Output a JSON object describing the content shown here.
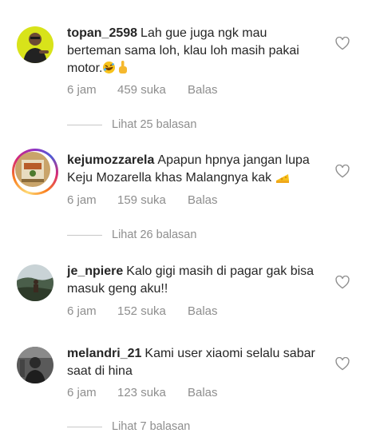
{
  "comments": [
    {
      "username": "topan_2598",
      "text": "Lah gue juga ngk mau berteman sama loh, klau loh masih pakai motor.",
      "emoji": [
        "rolling-laughing-emoji",
        "pointing-up-emoji"
      ],
      "time": "6 jam",
      "likes": "459 suka",
      "reply_label": "Balas",
      "view_replies": "Lihat 25 balasan"
    },
    {
      "username": "kejumozzarela",
      "text": "Apapun hpnya jangan lupa Keju Mozarella khas Malangnya kak",
      "emoji": [
        "cheese-emoji"
      ],
      "time": "6 jam",
      "likes": "159 suka",
      "reply_label": "Balas",
      "view_replies": "Lihat 26 balasan"
    },
    {
      "username": "je_npiere",
      "text": "Kalo gigi masih di pagar gak bisa masuk geng aku!!",
      "time": "6 jam",
      "likes": "152 suka",
      "reply_label": "Balas"
    },
    {
      "username": "melandri_21",
      "text": "Kami user xiaomi selalu sabar saat di hina",
      "time": "6 jam",
      "likes": "123 suka",
      "reply_label": "Balas",
      "view_replies": "Lihat 7 balasan"
    }
  ],
  "colors": {
    "text": "#262626",
    "meta": "#8e8e8e",
    "divider": "#c7c7c7"
  }
}
